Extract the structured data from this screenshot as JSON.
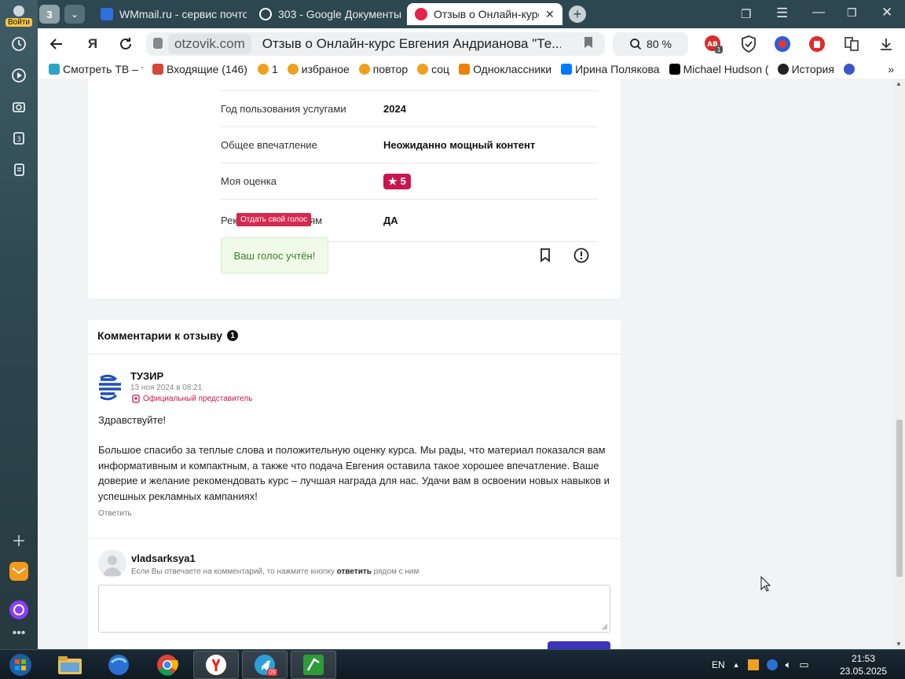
{
  "sidebar": {
    "login_label": "Войти",
    "items": [
      {
        "icon": "history-icon"
      },
      {
        "icon": "play-icon"
      },
      {
        "icon": "screenshot-icon"
      },
      {
        "icon": "collections-icon"
      },
      {
        "icon": "notes-icon"
      },
      {
        "icon": "plus-icon"
      },
      {
        "icon": "mail-icon"
      },
      {
        "icon": "alice-icon"
      },
      {
        "icon": "more-icon"
      }
    ]
  },
  "tabs": {
    "count": "3",
    "items": [
      {
        "title": "WMmail.ru - сервис почто",
        "color": "#2f6fe0"
      },
      {
        "title": "303 - Google Документы",
        "color": "#ffffff"
      },
      {
        "title": "Отзыв о Онлайн-курс Е",
        "color": "#e5234a",
        "active": true
      }
    ]
  },
  "toolbar": {
    "domain": "otzovik.com",
    "page_title": "Отзыв о Онлайн-курс Евгения Андрианова \"Те...",
    "zoom": "80 %"
  },
  "bookmarks": [
    {
      "label": "Смотреть ТВ – те",
      "color": "#2aa3c8"
    },
    {
      "label": "Входящие (146) -",
      "color": "#d44638"
    },
    {
      "label": "1",
      "color": "#f0a020"
    },
    {
      "label": "избраное",
      "color": "#f0a020"
    },
    {
      "label": "повтор",
      "color": "#f0a020"
    },
    {
      "label": "соц",
      "color": "#f0a020"
    },
    {
      "label": "Одноклассники",
      "color": "#ee8208"
    },
    {
      "label": "Ирина Полякова",
      "color": "#0077ff"
    },
    {
      "label": "Michael Hudson (@",
      "color": "#000000"
    },
    {
      "label": "История",
      "color": "#222222"
    }
  ],
  "review": {
    "rows": [
      {
        "key": "Год пользования услугами",
        "value": "2024"
      },
      {
        "key": "Общее впечатление",
        "value": "Неожиданно мощный контент"
      },
      {
        "key": "Моя оценка",
        "value": "5"
      },
      {
        "key": "Рекомендую друзьям",
        "value": "ДА"
      }
    ],
    "vote_tooltip": "Отдать свой голос",
    "vote_status": "Ваш голос учтён!"
  },
  "comments": {
    "title": "Комментарии к отзыву",
    "count": "1",
    "items": [
      {
        "author": "ТУЗИР",
        "date": "13 ноя 2024 в 08:21",
        "badge": "Официальный представитель",
        "greeting": "Здравствуйте!",
        "text": "Большое спасибо за теплые слова и положительную оценку курса. Мы рады, что материал показался вам информативным и компактным, а также что подача Евгения оставила такое хорошее впечатление. Ваше доверие и желание рекомендовать курс – лучшая награда для нас. Удачи вам в освоении новых навыков и успешных рекламных кампаниях!",
        "reply": "Ответить"
      }
    ],
    "form": {
      "username": "vladsarksya1",
      "hint_before": "Если Вы отвечаете на комментарий, то нажмите кнопку ",
      "hint_bold": "ответить",
      "hint_after": " рядом с ним"
    }
  },
  "taskbar": {
    "lang": "EN",
    "time": "21:53",
    "date": "23.05.2025",
    "telegram_badge": "09"
  }
}
